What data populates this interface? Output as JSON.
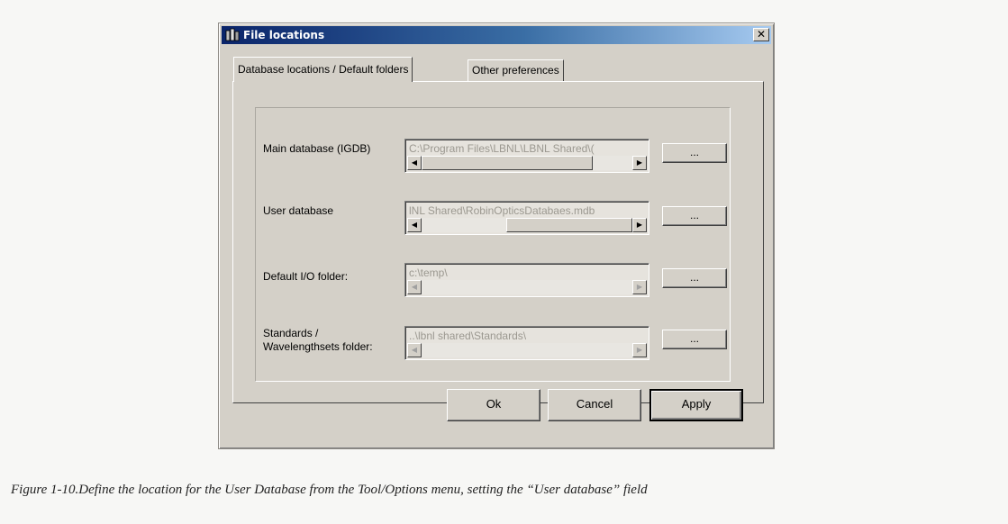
{
  "window": {
    "title": "File locations",
    "close_glyph": "✕"
  },
  "tabs": [
    {
      "label": "Database locations / Default folders",
      "active": true
    },
    {
      "label": "Other preferences",
      "active": false
    }
  ],
  "fields": {
    "main_db": {
      "label": "Main database (IGDB)",
      "value": "C:\\Program Files\\LBNL\\LBNL Shared\\(",
      "browse_label": "..."
    },
    "user_db": {
      "label": "User database",
      "value": "lNL Shared\\RobinOpticsDatabaes.mdb",
      "browse_label": "..."
    },
    "io_folder": {
      "label": "Default I/O folder:",
      "value": "c:\\temp\\",
      "browse_label": "..."
    },
    "standards": {
      "label_line1": "Standards /",
      "label_line2": "Wavelengthsets folder:",
      "value": "..\\lbnl shared\\Standards\\",
      "browse_label": "..."
    }
  },
  "buttons": {
    "ok": "Ok",
    "cancel": "Cancel",
    "apply": "Apply"
  },
  "caption": "Figure 1-10.Define the location for the User Database from the Tool/Options menu, setting the “User database” field",
  "icons": {
    "left_arrow": "◀",
    "right_arrow": "▶"
  }
}
